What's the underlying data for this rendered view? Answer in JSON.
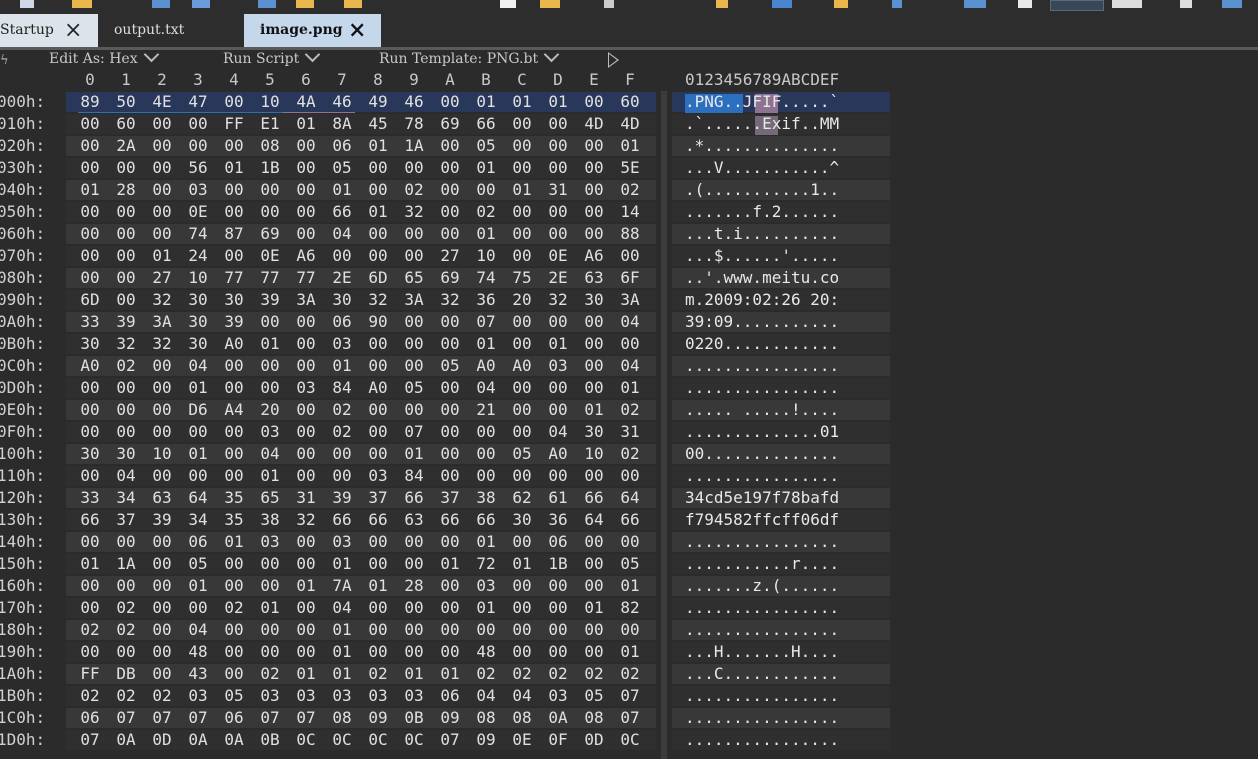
{
  "tabs": [
    {
      "label": "Startup",
      "style": "inactive-light",
      "closable": true
    },
    {
      "label": "output.txt",
      "style": "plain",
      "closable": false
    },
    {
      "label": "image.png",
      "style": "active",
      "closable": true
    }
  ],
  "editor_toolbar": {
    "edit_as": "Edit As: Hex",
    "run_script": "Run Script",
    "run_template": "Run Template: PNG.bt"
  },
  "columns": [
    "0",
    "1",
    "2",
    "3",
    "4",
    "5",
    "6",
    "7",
    "8",
    "9",
    "A",
    "B",
    "C",
    "D",
    "E",
    "F"
  ],
  "ascii_header": "0123456789ABCDEF",
  "rows": [
    {
      "addr": "000h:",
      "hex": [
        "89",
        "50",
        "4E",
        "47",
        "00",
        "10",
        "4A",
        "46",
        "49",
        "46",
        "00",
        "01",
        "01",
        "01",
        "00",
        "60"
      ],
      "ascii": ".PNG..JFIF.....`"
    },
    {
      "addr": "010h:",
      "hex": [
        "00",
        "60",
        "00",
        "00",
        "FF",
        "E1",
        "01",
        "8A",
        "45",
        "78",
        "69",
        "66",
        "00",
        "00",
        "4D",
        "4D"
      ],
      "ascii": ".`......Exif..MM"
    },
    {
      "addr": "020h:",
      "hex": [
        "00",
        "2A",
        "00",
        "00",
        "00",
        "08",
        "00",
        "06",
        "01",
        "1A",
        "00",
        "05",
        "00",
        "00",
        "00",
        "01"
      ],
      "ascii": ".*.............."
    },
    {
      "addr": "030h:",
      "hex": [
        "00",
        "00",
        "00",
        "56",
        "01",
        "1B",
        "00",
        "05",
        "00",
        "00",
        "00",
        "01",
        "00",
        "00",
        "00",
        "5E"
      ],
      "ascii": "...V...........^"
    },
    {
      "addr": "040h:",
      "hex": [
        "01",
        "28",
        "00",
        "03",
        "00",
        "00",
        "00",
        "01",
        "00",
        "02",
        "00",
        "00",
        "01",
        "31",
        "00",
        "02"
      ],
      "ascii": ".(...........1.."
    },
    {
      "addr": "050h:",
      "hex": [
        "00",
        "00",
        "00",
        "0E",
        "00",
        "00",
        "00",
        "66",
        "01",
        "32",
        "00",
        "02",
        "00",
        "00",
        "00",
        "14"
      ],
      "ascii": ".......f.2......"
    },
    {
      "addr": "060h:",
      "hex": [
        "00",
        "00",
        "00",
        "74",
        "87",
        "69",
        "00",
        "04",
        "00",
        "00",
        "00",
        "01",
        "00",
        "00",
        "00",
        "88"
      ],
      "ascii": "...t.i.........."
    },
    {
      "addr": "070h:",
      "hex": [
        "00",
        "00",
        "01",
        "24",
        "00",
        "0E",
        "A6",
        "00",
        "00",
        "00",
        "27",
        "10",
        "00",
        "0E",
        "A6",
        "00"
      ],
      "ascii": "...$......'....."
    },
    {
      "addr": "080h:",
      "hex": [
        "00",
        "00",
        "27",
        "10",
        "77",
        "77",
        "77",
        "2E",
        "6D",
        "65",
        "69",
        "74",
        "75",
        "2E",
        "63",
        "6F"
      ],
      "ascii": "..'.www.meitu.co"
    },
    {
      "addr": "090h:",
      "hex": [
        "6D",
        "00",
        "32",
        "30",
        "30",
        "39",
        "3A",
        "30",
        "32",
        "3A",
        "32",
        "36",
        "20",
        "32",
        "30",
        "3A"
      ],
      "ascii": "m.2009:02:26 20:"
    },
    {
      "addr": "0A0h:",
      "hex": [
        "33",
        "39",
        "3A",
        "30",
        "39",
        "00",
        "00",
        "06",
        "90",
        "00",
        "00",
        "07",
        "00",
        "00",
        "00",
        "04"
      ],
      "ascii": "39:09..........."
    },
    {
      "addr": "0B0h:",
      "hex": [
        "30",
        "32",
        "32",
        "30",
        "A0",
        "01",
        "00",
        "03",
        "00",
        "00",
        "00",
        "01",
        "00",
        "01",
        "00",
        "00"
      ],
      "ascii": "0220............"
    },
    {
      "addr": "0C0h:",
      "hex": [
        "A0",
        "02",
        "00",
        "04",
        "00",
        "00",
        "00",
        "01",
        "00",
        "00",
        "05",
        "A0",
        "A0",
        "03",
        "00",
        "04"
      ],
      "ascii": "................"
    },
    {
      "addr": "0D0h:",
      "hex": [
        "00",
        "00",
        "00",
        "01",
        "00",
        "00",
        "03",
        "84",
        "A0",
        "05",
        "00",
        "04",
        "00",
        "00",
        "00",
        "01"
      ],
      "ascii": "................"
    },
    {
      "addr": "0E0h:",
      "hex": [
        "00",
        "00",
        "00",
        "D6",
        "A4",
        "20",
        "00",
        "02",
        "00",
        "00",
        "00",
        "21",
        "00",
        "00",
        "01",
        "02"
      ],
      "ascii": "..... .....!...."
    },
    {
      "addr": "0F0h:",
      "hex": [
        "00",
        "00",
        "00",
        "00",
        "00",
        "03",
        "00",
        "02",
        "00",
        "07",
        "00",
        "00",
        "00",
        "04",
        "30",
        "31"
      ],
      "ascii": "..............01"
    },
    {
      "addr": "100h:",
      "hex": [
        "30",
        "30",
        "10",
        "01",
        "00",
        "04",
        "00",
        "00",
        "00",
        "01",
        "00",
        "00",
        "05",
        "A0",
        "10",
        "02"
      ],
      "ascii": "00.............."
    },
    {
      "addr": "110h:",
      "hex": [
        "00",
        "04",
        "00",
        "00",
        "00",
        "01",
        "00",
        "00",
        "03",
        "84",
        "00",
        "00",
        "00",
        "00",
        "00",
        "00"
      ],
      "ascii": "................"
    },
    {
      "addr": "120h:",
      "hex": [
        "33",
        "34",
        "63",
        "64",
        "35",
        "65",
        "31",
        "39",
        "37",
        "66",
        "37",
        "38",
        "62",
        "61",
        "66",
        "64"
      ],
      "ascii": "34cd5e197f78bafd"
    },
    {
      "addr": "130h:",
      "hex": [
        "66",
        "37",
        "39",
        "34",
        "35",
        "38",
        "32",
        "66",
        "66",
        "63",
        "66",
        "66",
        "30",
        "36",
        "64",
        "66"
      ],
      "ascii": "f794582ffcff06df"
    },
    {
      "addr": "140h:",
      "hex": [
        "00",
        "00",
        "00",
        "06",
        "01",
        "03",
        "00",
        "03",
        "00",
        "00",
        "00",
        "01",
        "00",
        "06",
        "00",
        "00"
      ],
      "ascii": "................"
    },
    {
      "addr": "150h:",
      "hex": [
        "01",
        "1A",
        "00",
        "05",
        "00",
        "00",
        "00",
        "01",
        "00",
        "00",
        "01",
        "72",
        "01",
        "1B",
        "00",
        "05"
      ],
      "ascii": "...........r...."
    },
    {
      "addr": "160h:",
      "hex": [
        "00",
        "00",
        "00",
        "01",
        "00",
        "00",
        "01",
        "7A",
        "01",
        "28",
        "00",
        "03",
        "00",
        "00",
        "00",
        "01"
      ],
      "ascii": ".......z.(......"
    },
    {
      "addr": "170h:",
      "hex": [
        "00",
        "02",
        "00",
        "00",
        "02",
        "01",
        "00",
        "04",
        "00",
        "00",
        "00",
        "01",
        "00",
        "00",
        "01",
        "82"
      ],
      "ascii": "................"
    },
    {
      "addr": "180h:",
      "hex": [
        "02",
        "02",
        "00",
        "04",
        "00",
        "00",
        "00",
        "01",
        "00",
        "00",
        "00",
        "00",
        "00",
        "00",
        "00",
        "00"
      ],
      "ascii": "................"
    },
    {
      "addr": "190h:",
      "hex": [
        "00",
        "00",
        "00",
        "48",
        "00",
        "00",
        "00",
        "01",
        "00",
        "00",
        "00",
        "48",
        "00",
        "00",
        "00",
        "01"
      ],
      "ascii": "...H.......H...."
    },
    {
      "addr": "1A0h:",
      "hex": [
        "FF",
        "DB",
        "00",
        "43",
        "00",
        "02",
        "01",
        "01",
        "02",
        "01",
        "01",
        "02",
        "02",
        "02",
        "02",
        "02"
      ],
      "ascii": "...C............"
    },
    {
      "addr": "1B0h:",
      "hex": [
        "02",
        "02",
        "02",
        "03",
        "05",
        "03",
        "03",
        "03",
        "03",
        "03",
        "06",
        "04",
        "04",
        "03",
        "05",
        "07"
      ],
      "ascii": "................"
    },
    {
      "addr": "1C0h:",
      "hex": [
        "06",
        "07",
        "07",
        "07",
        "06",
        "07",
        "07",
        "08",
        "09",
        "0B",
        "09",
        "08",
        "08",
        "0A",
        "08",
        "07"
      ],
      "ascii": "................"
    },
    {
      "addr": "1D0h:",
      "hex": [
        "07",
        "0A",
        "0D",
        "0A",
        "0A",
        "0B",
        "0C",
        "0C",
        "0C",
        "0C",
        "07",
        "09",
        "0E",
        "0F",
        "0D",
        "0C"
      ],
      "ascii": "................"
    }
  ]
}
